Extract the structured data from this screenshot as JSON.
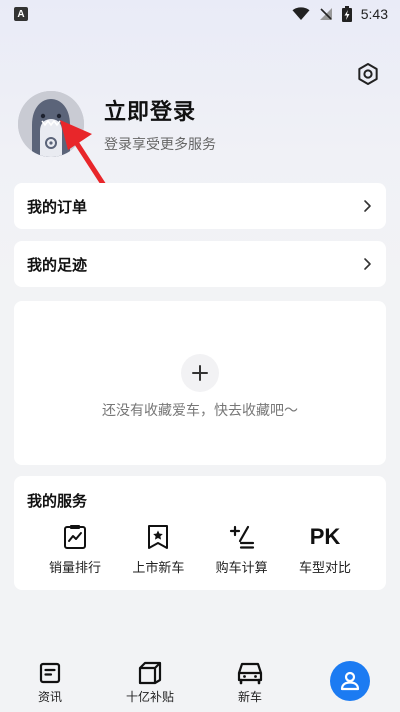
{
  "status_bar": {
    "app_badge": "A",
    "time": "5:43",
    "icons": [
      "wifi-icon",
      "no-signal-icon",
      "battery-charging-icon"
    ]
  },
  "profile": {
    "title": "立即登录",
    "subtitle": "登录享受更多服务"
  },
  "menu": {
    "orders_label": "我的订单",
    "footprint_label": "我的足迹"
  },
  "favorites": {
    "empty_text": "还没有收藏爱车，快去收藏吧～"
  },
  "services": {
    "title": "我的服务",
    "items": [
      {
        "label": "销量排行",
        "icon": "sales-chart-icon"
      },
      {
        "label": "上市新车",
        "icon": "star-bookmark-icon"
      },
      {
        "label": "购车计算",
        "icon": "calculator-icon"
      },
      {
        "label": "车型对比",
        "icon": "PK"
      }
    ]
  },
  "bottom_nav": {
    "items": [
      {
        "label": "资讯",
        "icon": "news-icon"
      },
      {
        "label": "十亿补贴",
        "icon": "subsidy-box-icon"
      },
      {
        "label": "新车",
        "icon": "car-icon"
      },
      {
        "label": "",
        "icon": "user-profile-icon",
        "active": true
      }
    ]
  },
  "colors": {
    "accent": "#1c7bf2",
    "arrow": "#e8262a",
    "background": "#f2f3f5"
  }
}
